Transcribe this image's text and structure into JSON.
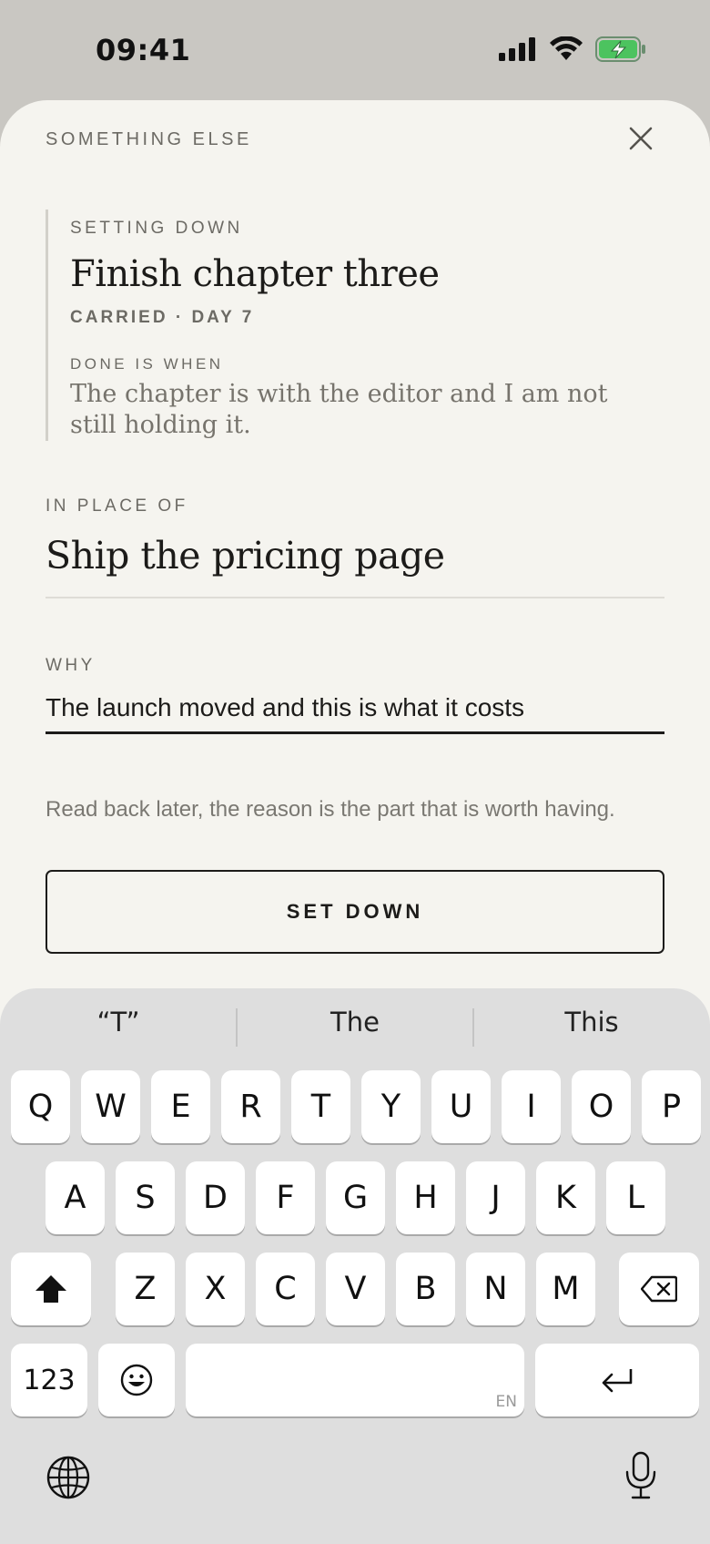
{
  "status": {
    "time": "09:41",
    "battery_color": "#4cc35f"
  },
  "sheet": {
    "title": "SOMETHING ELSE"
  },
  "setting_down": {
    "eyebrow": "SETTING DOWN",
    "title": "Finish chapter three",
    "meta": "CARRIED · DAY 7",
    "done_label": "DONE IS WHEN",
    "done_text": "The chapter is with the editor and I am not still holding it."
  },
  "in_place_of": {
    "label": "IN PLACE OF",
    "value": "Ship the pricing page"
  },
  "why": {
    "label": "WHY",
    "value": "The launch moved and this is what it costs"
  },
  "hint": "Read back later, the reason is the part that is worth having.",
  "primary_action": "SET DOWN",
  "keyboard": {
    "suggestions": [
      "“T”",
      "The",
      "This"
    ],
    "row1": [
      "Q",
      "W",
      "E",
      "R",
      "T",
      "Y",
      "U",
      "I",
      "O",
      "P"
    ],
    "row2": [
      "A",
      "S",
      "D",
      "F",
      "G",
      "H",
      "J",
      "K",
      "L"
    ],
    "row3": [
      "Z",
      "X",
      "C",
      "V",
      "B",
      "N",
      "M"
    ],
    "numbers_label": "123",
    "space_lang": "EN",
    "icons": [
      "shift-icon",
      "backspace-icon",
      "emoji-icon",
      "return-icon",
      "globe-icon",
      "microphone-icon"
    ]
  }
}
